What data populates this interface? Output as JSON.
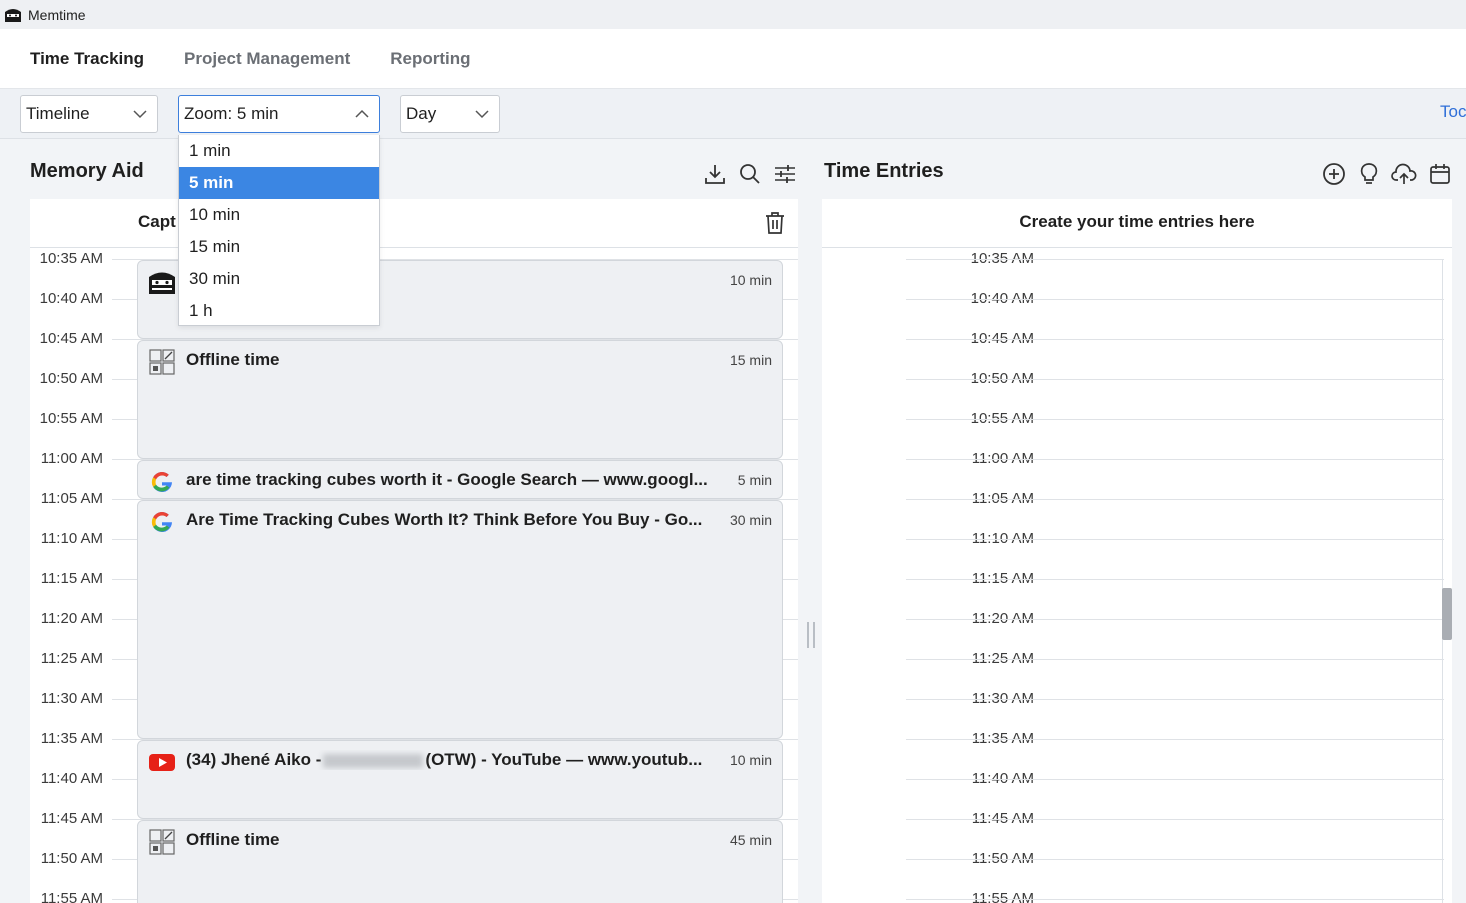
{
  "window": {
    "title": "Memtime"
  },
  "nav": {
    "tabs": [
      {
        "label": "Time Tracking",
        "active": true
      },
      {
        "label": "Project Management",
        "active": false
      },
      {
        "label": "Reporting",
        "active": false
      }
    ]
  },
  "toolbar": {
    "view_select": "Timeline",
    "zoom_select": "Zoom: 5 min",
    "period_select": "Day",
    "today_label": "Toc"
  },
  "zoom_dropdown": {
    "selected": "5 min",
    "options": [
      "1 min",
      "5 min",
      "10 min",
      "15 min",
      "30 min",
      "1 h"
    ]
  },
  "memory_aid": {
    "title": "Memory Aid",
    "header_label": "Capt",
    "icons": [
      "download-icon",
      "search-icon",
      "filter-sliders-icon",
      "trash-icon"
    ],
    "times": [
      "10:35 AM",
      "10:40 AM",
      "10:45 AM",
      "10:50 AM",
      "10:55 AM",
      "11:00 AM",
      "11:05 AM",
      "11:10 AM",
      "11:15 AM",
      "11:20 AM",
      "11:25 AM",
      "11:30 AM",
      "11:35 AM",
      "11:40 AM",
      "11:45 AM",
      "11:50 AM",
      "11:55 AM"
    ],
    "blocks": [
      {
        "icon": "memtime-logo-icon",
        "title": "",
        "duration": "10 min"
      },
      {
        "icon": "offline-apps-icon",
        "title": "Offline time",
        "duration": "15 min"
      },
      {
        "icon": "google-icon",
        "title": "are time tracking cubes worth it - Google Search — www.googl...",
        "duration": "5 min"
      },
      {
        "icon": "google-icon",
        "title": "Are Time Tracking Cubes Worth It? Think Before You Buy - Go...",
        "duration": "30 min"
      },
      {
        "icon": "youtube-icon",
        "title_prefix": "(34) Jhené Aiko -",
        "title_suffix": "(OTW) - YouTube — www.youtub...",
        "duration": "10 min"
      },
      {
        "icon": "offline-apps-icon",
        "title": "Offline time",
        "duration": "45 min"
      }
    ]
  },
  "time_entries": {
    "title": "Time Entries",
    "header_label": "Create your time entries here",
    "icons": [
      "add-circle-icon",
      "lightbulb-icon",
      "cloud-upload-icon",
      "calendar-icon"
    ],
    "times": [
      "10:35 AM",
      "10:40 AM",
      "10:45 AM",
      "10:50 AM",
      "10:55 AM",
      "11:00 AM",
      "11:05 AM",
      "11:10 AM",
      "11:15 AM",
      "11:20 AM",
      "11:25 AM",
      "11:30 AM",
      "11:35 AM",
      "11:40 AM",
      "11:45 AM",
      "11:50 AM",
      "11:55 AM"
    ]
  },
  "colors": {
    "accent": "#3b86e3",
    "link": "#2f6fd8",
    "block_bg": "#eef0f3"
  }
}
